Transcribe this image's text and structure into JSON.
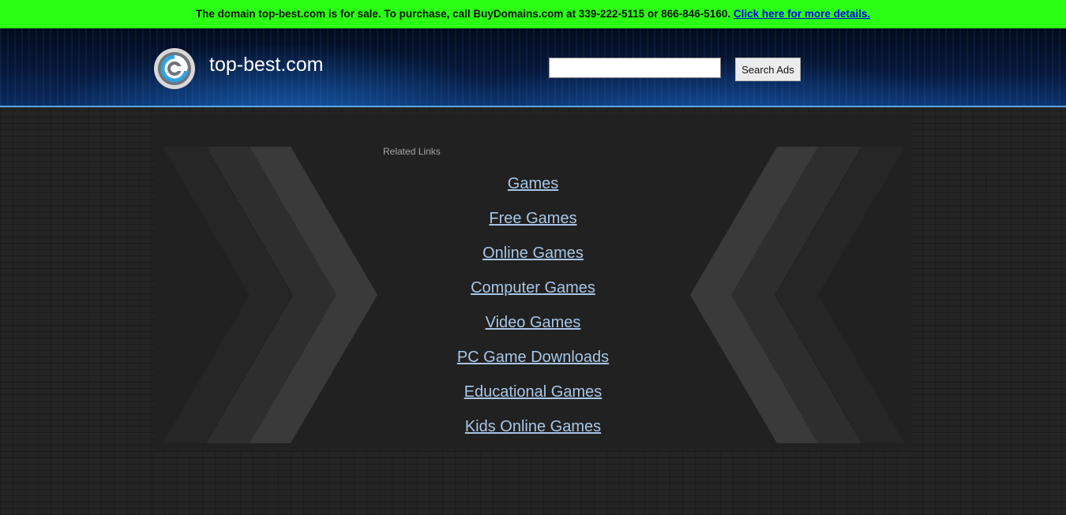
{
  "sale_bar": {
    "message": "The domain top-best.com is for sale. To purchase, call BuyDomains.com at 339-222-5115 or 866-846-5160.",
    "link_text": "Click here for more details.",
    "background_color": "#2bff14"
  },
  "header": {
    "site_name": "top-best.com",
    "logo_icon": "circular-logo-icon",
    "search": {
      "value": "",
      "placeholder": "",
      "button_label": "Search Ads"
    }
  },
  "related": {
    "heading": "Related Links",
    "links": [
      {
        "label": "Games"
      },
      {
        "label": "Free Games"
      },
      {
        "label": "Online Games"
      },
      {
        "label": "Computer Games"
      },
      {
        "label": "Video Games"
      },
      {
        "label": "PC Game Downloads"
      },
      {
        "label": "Educational Games"
      },
      {
        "label": "Kids Online Games"
      }
    ]
  },
  "colors": {
    "link": "#a8c6e6",
    "header_border": "#5aa7e8",
    "page_background": "#242424"
  }
}
